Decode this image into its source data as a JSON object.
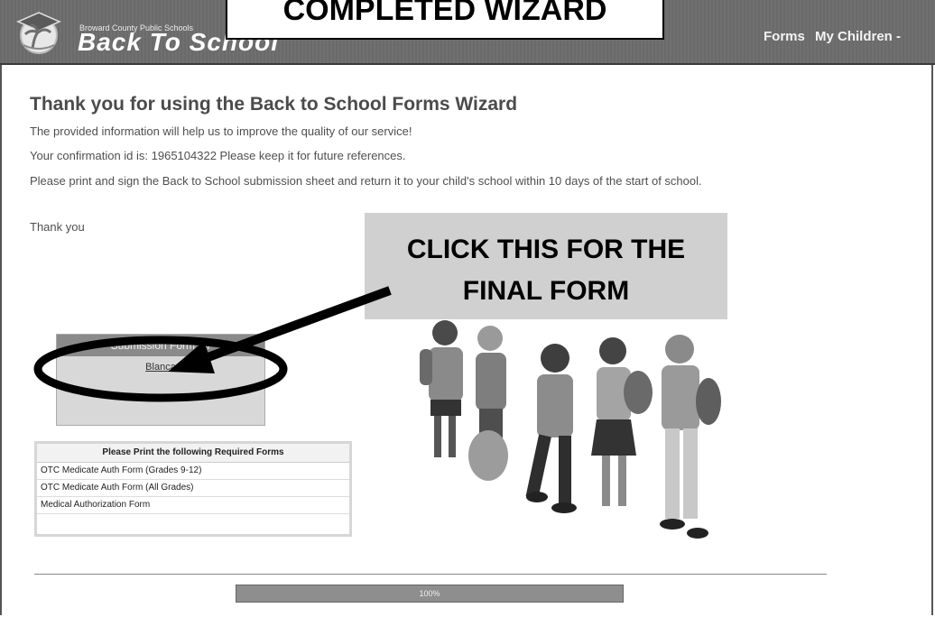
{
  "header": {
    "logo_small": "Broward County Public Schools",
    "logo_big": "Back To School",
    "nav_forms": "Forms",
    "nav_children": "My Children -"
  },
  "top_callout": "COMPLETED WIZARD",
  "main": {
    "title": "Thank you for using the Back to School Forms Wizard",
    "p1": "The provided information will help us to improve the quality of our service!",
    "p2": "Your confirmation id is: 1965104322 Please keep it for future references.",
    "p3": "Please print and sign the Back to School submission sheet and return it to your child's school within 10 days of the start of school.",
    "p4": "Thank you"
  },
  "click_callout": {
    "line1": "CLICK THIS FOR THE",
    "line2": "FINAL FORM"
  },
  "submission": {
    "header": "Submission Form for",
    "link": "Blanca"
  },
  "required_forms": {
    "header": "Please Print the following Required Forms",
    "items": [
      "OTC Medicate Auth Form (Grades 9-12)",
      "OTC Medicate Auth Form (All Grades)",
      "Medical Authorization Form"
    ]
  },
  "progress": {
    "label": "100%",
    "value": 100
  }
}
